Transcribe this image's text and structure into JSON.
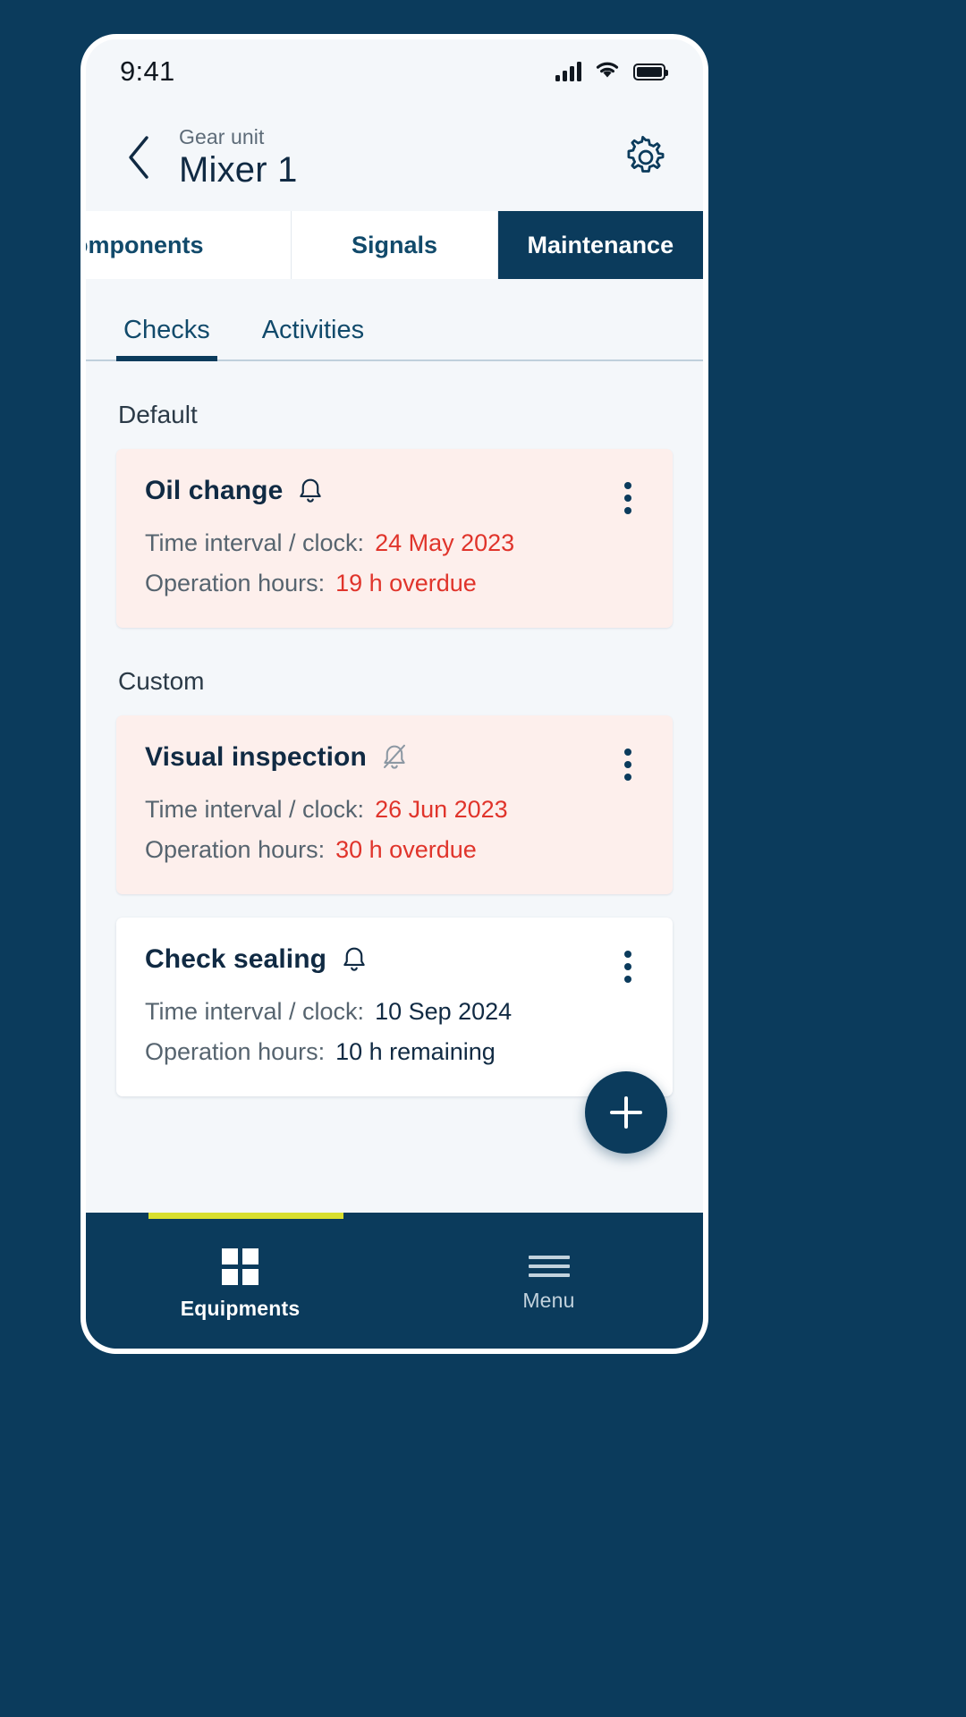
{
  "status_bar": {
    "time": "9:41",
    "signal_icon": "cellular-signal-icon",
    "wifi_icon": "wifi-icon",
    "battery_icon": "battery-full-icon"
  },
  "app_bar": {
    "back_icon": "chevron-left-icon",
    "eyebrow": "Gear unit",
    "title": "Mixer 1",
    "settings_icon": "gear-icon"
  },
  "main_tabs": [
    {
      "label": "omponents",
      "active": false,
      "clipped": true
    },
    {
      "label": "Signals",
      "active": false,
      "clipped": false
    },
    {
      "label": "Maintenance",
      "active": true,
      "clipped": false
    }
  ],
  "sub_tabs": [
    {
      "label": "Checks",
      "active": true
    },
    {
      "label": "Activities",
      "active": false
    }
  ],
  "sections": [
    {
      "label": "Default",
      "cards": [
        {
          "title": "Oil change",
          "bell_icon": "bell-icon",
          "bell_muted": false,
          "state": "overdue",
          "menu_icon": "kebab-menu-icon",
          "rows": [
            {
              "label": "Time interval / clock:",
              "value": "24 May 2023",
              "alert": true
            },
            {
              "label": "Operation hours:",
              "value": "19 h overdue",
              "alert": true
            }
          ]
        }
      ]
    },
    {
      "label": "Custom",
      "cards": [
        {
          "title": "Visual inspection",
          "bell_icon": "bell-off-icon",
          "bell_muted": true,
          "state": "overdue",
          "menu_icon": "kebab-menu-icon",
          "rows": [
            {
              "label": "Time interval / clock:",
              "value": "26 Jun 2023",
              "alert": true
            },
            {
              "label": "Operation hours:",
              "value": "30 h overdue",
              "alert": true
            }
          ]
        },
        {
          "title": "Check sealing",
          "bell_icon": "bell-icon",
          "bell_muted": false,
          "state": "normal",
          "menu_icon": "kebab-menu-icon",
          "rows": [
            {
              "label": "Time interval / clock:",
              "value": "10 Sep 2024",
              "alert": false
            },
            {
              "label": "Operation hours:",
              "value": "10 h remaining",
              "alert": false
            }
          ]
        }
      ]
    }
  ],
  "fab": {
    "icon": "plus-icon"
  },
  "bottom_nav": [
    {
      "label": "Equipments",
      "icon": "grid-icon",
      "active": true
    },
    {
      "label": "Menu",
      "icon": "hamburger-icon",
      "active": false
    }
  ],
  "colors": {
    "brand_navy": "#0B3B5C",
    "alert_red": "#E0342B",
    "alert_bg": "#FDEFEC",
    "accent_lime": "#D8DF2E",
    "screen_bg": "#F4F7FA"
  }
}
